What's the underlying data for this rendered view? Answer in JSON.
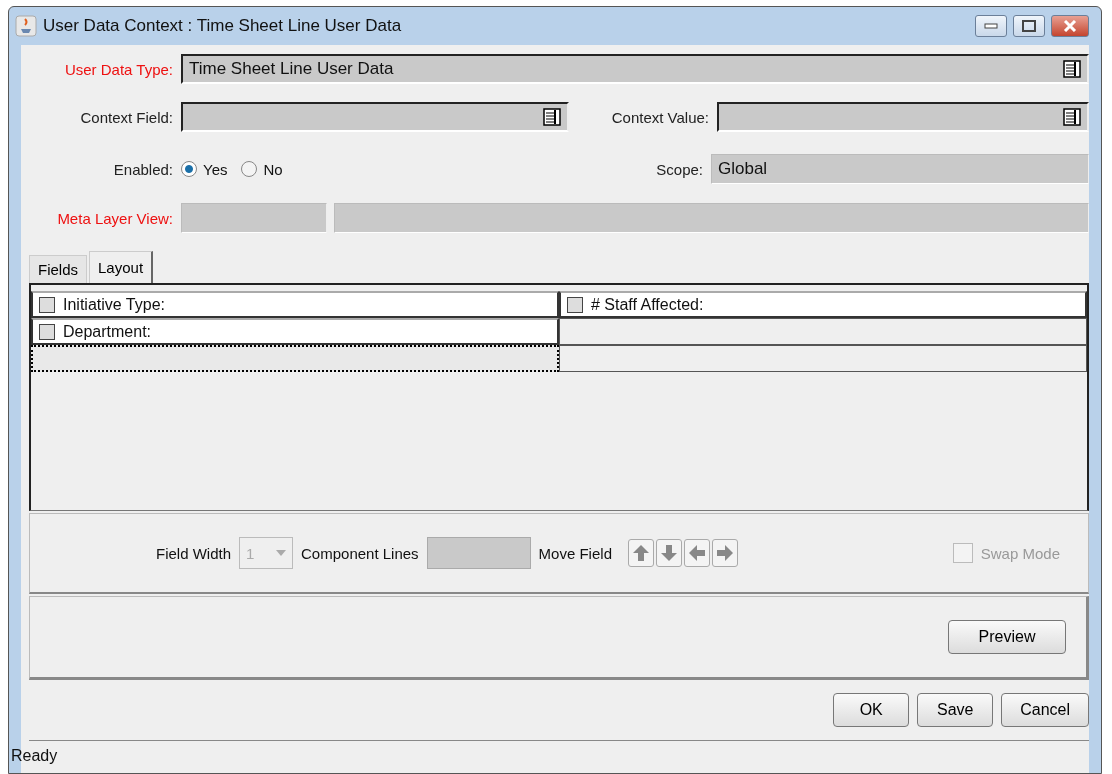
{
  "window": {
    "title": "User Data Context : Time Sheet Line User Data"
  },
  "user_data_type": {
    "label": "User Data Type:",
    "value": "Time Sheet Line User Data",
    "required": true
  },
  "context_field": {
    "label": "Context Field:",
    "required": false
  },
  "context_value": {
    "label": "Context Value:",
    "required": false
  },
  "enabled": {
    "label": "Enabled:",
    "options": [
      {
        "label": "Yes",
        "selected": true
      },
      {
        "label": "No",
        "selected": false
      }
    ]
  },
  "scope": {
    "label": "Scope:",
    "value": "Global"
  },
  "meta_layer_view": {
    "label": "Meta Layer View:",
    "required": true
  },
  "tabs": [
    {
      "label": "Fields",
      "selected": false
    },
    {
      "label": "Layout",
      "selected": true
    }
  ],
  "layout_grid": [
    [
      {
        "kind": "field",
        "label": "Initiative Type:",
        "checked": false,
        "selected": false
      },
      {
        "kind": "field",
        "label": "# Staff Affected:",
        "checked": false,
        "selected": false
      }
    ],
    [
      {
        "kind": "field",
        "label": "Department:",
        "checked": false,
        "selected": false
      },
      {
        "kind": "empty",
        "selected": false
      }
    ],
    [
      {
        "kind": "empty",
        "selected": true
      },
      {
        "kind": "empty",
        "selected": false
      }
    ]
  ],
  "toolbar": {
    "field_width_label": "Field Width",
    "field_width_value": "1",
    "component_lines_label": "Component Lines",
    "move_field_label": "Move Field",
    "swap_mode": {
      "label": "Swap Mode",
      "checked": false,
      "disabled": true
    }
  },
  "preview_button": "Preview",
  "buttons": [
    "OK",
    "Save",
    "Cancel"
  ],
  "status_bar": "Ready"
}
